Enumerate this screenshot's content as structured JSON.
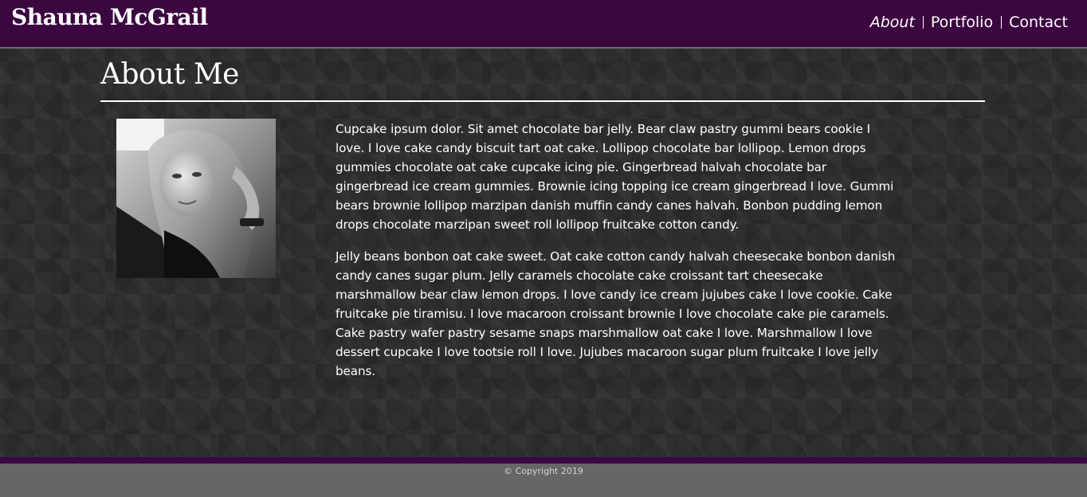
{
  "header": {
    "site_title": "Shauna McGrail",
    "nav": [
      {
        "label": "About",
        "active": true
      },
      {
        "label": "Portfolio",
        "active": false
      },
      {
        "label": "Contact",
        "active": false
      }
    ]
  },
  "main": {
    "heading": "About Me",
    "bio_paragraphs": [
      "Cupcake ipsum dolor. Sit amet chocolate bar jelly. Bear claw pastry gummi bears cookie I love. I love cake candy biscuit tart oat cake. Lollipop chocolate bar lollipop. Lemon drops gummies chocolate oat cake cupcake icing pie. Gingerbread halvah chocolate bar gingerbread ice cream gummies. Brownie icing topping ice cream gingerbread I love. Gummi bears brownie lollipop marzipan danish muffin candy canes halvah. Bonbon pudding lemon drops chocolate marzipan sweet roll lollipop fruitcake cotton candy.",
      "Jelly beans bonbon oat cake sweet. Oat cake cotton candy halvah cheesecake bonbon danish candy canes sugar plum. Jelly caramels chocolate cake croissant tart cheesecake marshmallow bear claw lemon drops. I love candy ice cream jujubes cake I love cookie. Cake fruitcake pie tiramisu. I love macaroon croissant brownie I love chocolate cake pie caramels. Cake pastry wafer pastry sesame snaps marshmallow oat cake I love. Marshmallow I love dessert cupcake I love tootsie roll I love. Jujubes macaroon sugar plum fruitcake I love jelly beans."
    ]
  },
  "footer": {
    "copyright": "© Copyright 2019"
  },
  "colors": {
    "header_bg": "#3c0741",
    "page_bg": "#2f2f2f",
    "footer_bg": "#666666",
    "text": "#ffffff"
  },
  "icons": {
    "portrait": "profile-photo"
  }
}
